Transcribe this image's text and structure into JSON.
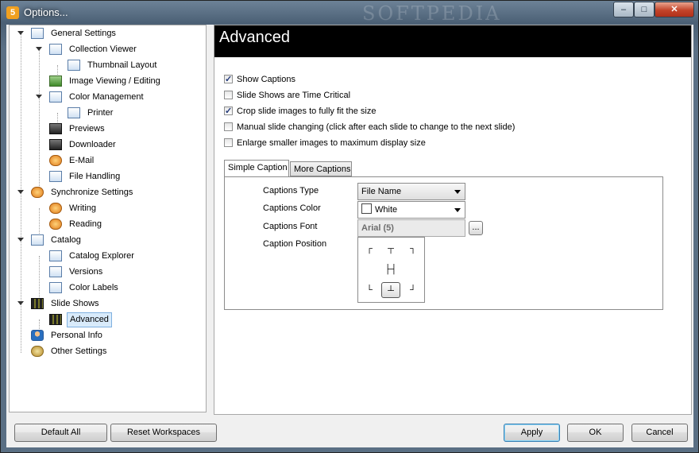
{
  "window": {
    "title": "Options...",
    "watermark": "SOFTPEDIA",
    "controls": {
      "minimize": "–",
      "maximize": "□",
      "close": "✕"
    }
  },
  "tree": {
    "items": [
      {
        "label": "General Settings",
        "icon": "settings-window-icon"
      },
      {
        "label": "Collection Viewer",
        "icon": "monitor-icon"
      },
      {
        "label": "Thumbnail Layout",
        "icon": "monitor-icon"
      },
      {
        "label": "Image Viewing / Editing",
        "icon": "image-icon"
      },
      {
        "label": "Color Management",
        "icon": "monitor-color-icon"
      },
      {
        "label": "Printer",
        "icon": "monitor-icon"
      },
      {
        "label": "Previews",
        "icon": "previews-icon"
      },
      {
        "label": "Downloader",
        "icon": "camera-icon"
      },
      {
        "label": "E-Mail",
        "icon": "email-icon"
      },
      {
        "label": "File Handling",
        "icon": "file-window-icon"
      },
      {
        "label": "Synchronize Settings",
        "icon": "sync-icon"
      },
      {
        "label": "Writing",
        "icon": "sync-icon"
      },
      {
        "label": "Reading",
        "icon": "sync-icon"
      },
      {
        "label": "Catalog",
        "icon": "catalog-icon"
      },
      {
        "label": "Catalog Explorer",
        "icon": "catalog-icon"
      },
      {
        "label": "Versions",
        "icon": "catalog-icon"
      },
      {
        "label": "Color Labels",
        "icon": "catalog-icon"
      },
      {
        "label": "Slide Shows",
        "icon": "filmstrip-icon"
      },
      {
        "label": "Advanced",
        "icon": "filmstrip-icon"
      },
      {
        "label": "Personal Info",
        "icon": "user-icon"
      },
      {
        "label": "Other Settings",
        "icon": "gears-icon"
      }
    ],
    "selected": "Advanced"
  },
  "panel": {
    "title": "Advanced",
    "options": [
      {
        "label": "Show Captions",
        "checked": true
      },
      {
        "label": "Slide Shows are Time Critical",
        "checked": false
      },
      {
        "label": "Crop slide images to fully fit the size",
        "checked": true
      },
      {
        "label": "Manual slide changing (click after each slide to change to the next slide)",
        "checked": false
      },
      {
        "label": "Enlarge smaller images to maximum display size",
        "checked": false
      }
    ],
    "tabs": [
      {
        "label": "Simple Caption",
        "active": true
      },
      {
        "label": "More Captions",
        "active": false
      }
    ],
    "fields": {
      "captions_type": {
        "label": "Captions Type",
        "value": "File Name"
      },
      "captions_color": {
        "label": "Captions Color",
        "value": "White",
        "swatch": "#ffffff"
      },
      "captions_font": {
        "label": "Captions Font",
        "value": "Arial (5)",
        "browse": "..."
      },
      "caption_position": {
        "label": "Caption Position",
        "selected": "bottom-center"
      }
    }
  },
  "buttons": {
    "default_all": "Default All",
    "reset_workspaces": "Reset Workspaces",
    "apply": "Apply",
    "ok": "OK",
    "cancel": "Cancel"
  }
}
